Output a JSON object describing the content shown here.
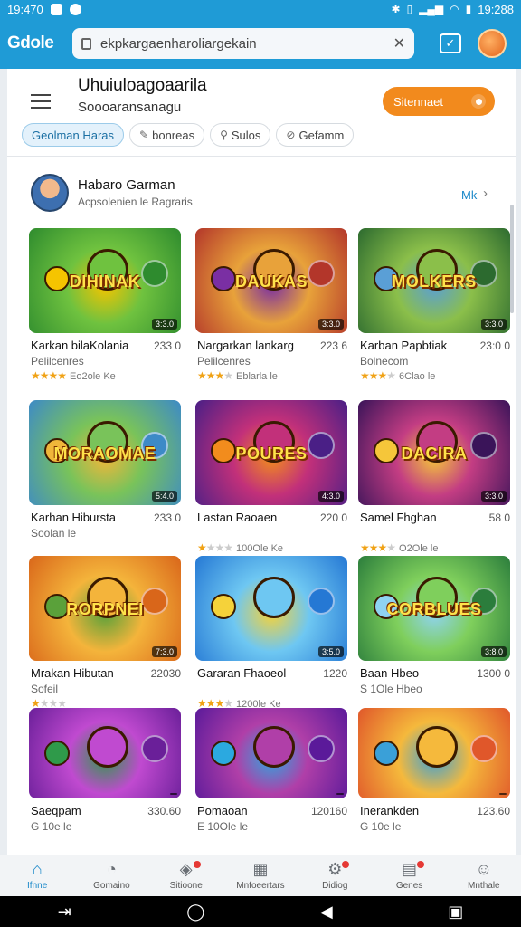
{
  "status_bar": {
    "time_left": "19:470",
    "time_right": "19:288"
  },
  "browser": {
    "logo": "Gdole",
    "url": "ekpkargaenharoliargekain"
  },
  "header": {
    "title": "Uhuiuloagoaarila",
    "subtitle": "Soooaransanagu",
    "cta_label": "Sitennaet"
  },
  "chips": [
    {
      "label": "Geolman Haras",
      "icon": ""
    },
    {
      "label": "bonreas",
      "icon": "✎"
    },
    {
      "label": "Sulos",
      "icon": "⚲"
    },
    {
      "label": "Gefamm",
      "icon": "⊘"
    }
  ],
  "section": {
    "title": "Habaro Garman",
    "subtitle": "Acpsolenien le Ragraris",
    "more": "Mk"
  },
  "games": [
    {
      "thumb_title": "DIHINAK",
      "name": "Karkan bilaKolania",
      "count": "233 0",
      "sub": "Pelilcenres",
      "stars": 4,
      "star_label": "Eo2ole Ke",
      "rating": "3:3.0",
      "colors": [
        "#2e8b2e",
        "#6fc23f",
        "#f5c400"
      ]
    },
    {
      "thumb_title": "DAUKAS",
      "name": "Nargarkan lankarg",
      "count": "223 6",
      "sub": "Pelilcenres",
      "stars": 3,
      "star_label": "Eblarla le",
      "rating": "3:3.0",
      "colors": [
        "#b3362a",
        "#e8a23a",
        "#7a2fa3"
      ]
    },
    {
      "thumb_title": "MOLKERS",
      "name": "Karban Papbtiak",
      "count": "23:0 0",
      "sub": "Bolnecom",
      "stars": 3,
      "star_label": "6Clao le",
      "rating": "3:3.0",
      "colors": [
        "#2c6a2f",
        "#8bbf4a",
        "#5a9fd6"
      ]
    },
    {
      "thumb_title": "MORAOMAE",
      "name": "Karhan Hibursta",
      "count": "233 0",
      "sub": "Soolan le",
      "stars": 0,
      "star_label": "",
      "rating": "5:4.0",
      "colors": [
        "#3d8ac7",
        "#79c35a",
        "#f0b63a"
      ]
    },
    {
      "thumb_title": "POURES",
      "name": "Lastan Raoaen",
      "count": "220 0",
      "sub": "",
      "stars": 1,
      "star_label": "100Ole Ke",
      "rating": "4:3.0",
      "colors": [
        "#4a1f86",
        "#c2307a",
        "#f28c1d"
      ]
    },
    {
      "thumb_title": "DACIRA",
      "name": "Samel Fhghan",
      "count": "58 0",
      "sub": "",
      "stars": 3,
      "star_label": "O2Ole le",
      "rating": "3:3.0",
      "colors": [
        "#3a1459",
        "#c33d83",
        "#f5c63a"
      ]
    },
    {
      "thumb_title": "RORPNEI",
      "name": "Mrakan Hibutan",
      "count": "22030",
      "sub": "Sofeil",
      "stars": 1,
      "star_label": "",
      "rating": "7:3.0",
      "colors": [
        "#d9661a",
        "#f4b43b",
        "#5aa13a"
      ]
    },
    {
      "thumb_title": "",
      "name": "Gararan Fhaoeol",
      "count": "1220",
      "sub": "",
      "stars": 3,
      "star_label": "1200le Ke",
      "rating": "3:5.0",
      "colors": [
        "#2578d4",
        "#6ec7f2",
        "#f5d23a"
      ]
    },
    {
      "thumb_title": "CORBLUES",
      "name": "Baan Hbeo",
      "count": "1300 0",
      "sub": "S 1Ole Hbeo",
      "stars": 0,
      "star_label": "",
      "rating": "3:8.0",
      "colors": [
        "#2b7d3c",
        "#7fcf5c",
        "#8fd3f2"
      ]
    },
    {
      "thumb_title": "",
      "name": "Saeqpam",
      "count": "330.60",
      "sub": "G 10e le",
      "stars": 0,
      "star_label": "",
      "rating": "",
      "colors": [
        "#6a1f99",
        "#c04ad0",
        "#2f9a4a"
      ]
    },
    {
      "thumb_title": "",
      "name": "Pomaoan",
      "count": "120160",
      "sub": "E 10Ole le",
      "stars": 0,
      "star_label": "",
      "rating": "",
      "colors": [
        "#5b1a9a",
        "#b03fa8",
        "#2ba9e0"
      ]
    },
    {
      "thumb_title": "",
      "name": "Inerankden",
      "count": "123.60",
      "sub": "G 10e le",
      "stars": 0,
      "star_label": "",
      "rating": "",
      "colors": [
        "#e0572a",
        "#f5b93c",
        "#3aa0d8"
      ]
    }
  ],
  "bottom_nav": [
    {
      "label": "Ifnne",
      "icon": "⌂",
      "active": true,
      "badge": false
    },
    {
      "label": "Gomaino",
      "icon": "◔",
      "active": false,
      "badge": false
    },
    {
      "label": "Sitioone",
      "icon": "◈",
      "active": false,
      "badge": true
    },
    {
      "label": "Mnfoeertars",
      "icon": "▦",
      "active": false,
      "badge": false
    },
    {
      "label": "Didiog",
      "icon": "⚙",
      "active": false,
      "badge": true
    },
    {
      "label": "Genes",
      "icon": "▤",
      "active": false,
      "badge": true
    },
    {
      "label": "Mnthale",
      "icon": "☺",
      "active": false,
      "badge": false
    }
  ],
  "system_nav": {
    "back": "◀",
    "home": "◯",
    "recents": "▣",
    "menu": "⇥"
  }
}
